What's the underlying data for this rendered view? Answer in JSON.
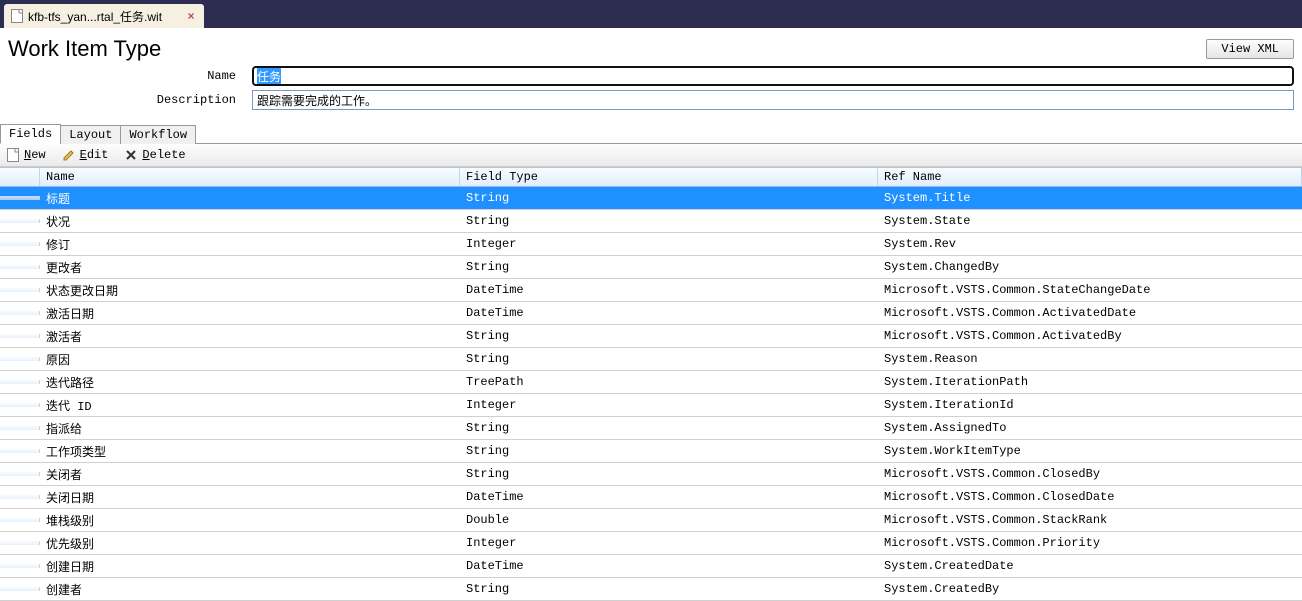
{
  "tab": {
    "file_label": "kfb-tfs_yan...rtal_任务.wit"
  },
  "page": {
    "title": "Work Item Type",
    "view_xml_label": "View XML"
  },
  "form": {
    "name_label": "Name",
    "name_value": "任务",
    "desc_label": "Description",
    "desc_value": "跟踪需要完成的工作。"
  },
  "tabs": [
    {
      "id": "fields",
      "label": "Fields",
      "active": true
    },
    {
      "id": "layout",
      "label": "Layout",
      "active": false
    },
    {
      "id": "workflow",
      "label": "Workflow",
      "active": false
    }
  ],
  "toolbar": {
    "new_label": "New",
    "edit_label": "Edit",
    "delete_label": "Delete"
  },
  "grid": {
    "columns": {
      "name": "Name",
      "field_type": "Field Type",
      "ref_name": "Ref Name"
    },
    "rows": [
      {
        "name": "标题",
        "type": "String",
        "ref": "System.Title",
        "selected": true
      },
      {
        "name": "状况",
        "type": "String",
        "ref": "System.State"
      },
      {
        "name": "修订",
        "type": "Integer",
        "ref": "System.Rev"
      },
      {
        "name": "更改者",
        "type": "String",
        "ref": "System.ChangedBy"
      },
      {
        "name": "状态更改日期",
        "type": "DateTime",
        "ref": "Microsoft.VSTS.Common.StateChangeDate"
      },
      {
        "name": "激活日期",
        "type": "DateTime",
        "ref": "Microsoft.VSTS.Common.ActivatedDate"
      },
      {
        "name": "激活者",
        "type": "String",
        "ref": "Microsoft.VSTS.Common.ActivatedBy"
      },
      {
        "name": "原因",
        "type": "String",
        "ref": "System.Reason"
      },
      {
        "name": "迭代路径",
        "type": "TreePath",
        "ref": "System.IterationPath"
      },
      {
        "name": "迭代 ID",
        "type": "Integer",
        "ref": "System.IterationId"
      },
      {
        "name": "指派给",
        "type": "String",
        "ref": "System.AssignedTo"
      },
      {
        "name": "工作项类型",
        "type": "String",
        "ref": "System.WorkItemType"
      },
      {
        "name": "关闭者",
        "type": "String",
        "ref": "Microsoft.VSTS.Common.ClosedBy"
      },
      {
        "name": "关闭日期",
        "type": "DateTime",
        "ref": "Microsoft.VSTS.Common.ClosedDate"
      },
      {
        "name": "堆栈级别",
        "type": "Double",
        "ref": "Microsoft.VSTS.Common.StackRank"
      },
      {
        "name": "优先级别",
        "type": "Integer",
        "ref": "Microsoft.VSTS.Common.Priority"
      },
      {
        "name": "创建日期",
        "type": "DateTime",
        "ref": "System.CreatedDate"
      },
      {
        "name": "创建者",
        "type": "String",
        "ref": "System.CreatedBy"
      }
    ]
  }
}
